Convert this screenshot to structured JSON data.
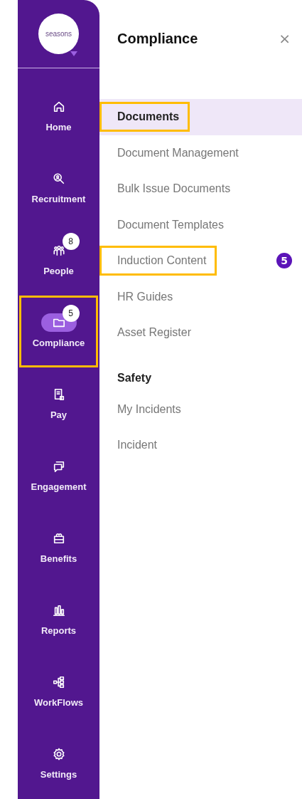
{
  "logo": {
    "text": "seasons"
  },
  "nav": [
    {
      "label": "Home",
      "kind": "home",
      "selected": false,
      "highlighted": false
    },
    {
      "label": "Recruitment",
      "kind": "recruit",
      "selected": false,
      "highlighted": false
    },
    {
      "label": "People",
      "kind": "people",
      "selected": false,
      "highlighted": false,
      "badge": "8"
    },
    {
      "label": "Compliance",
      "kind": "compliance",
      "selected": true,
      "highlighted": true,
      "badge": "5"
    },
    {
      "label": "Pay",
      "kind": "pay",
      "selected": false,
      "highlighted": false
    },
    {
      "label": "Engagement",
      "kind": "engagement",
      "selected": false,
      "highlighted": false
    },
    {
      "label": "Benefits",
      "kind": "benefits",
      "selected": false,
      "highlighted": false
    },
    {
      "label": "Reports",
      "kind": "reports",
      "selected": false,
      "highlighted": false
    },
    {
      "label": "WorkFlows",
      "kind": "workflows",
      "selected": false,
      "highlighted": false
    },
    {
      "label": "Settings",
      "kind": "settings",
      "selected": false,
      "highlighted": false
    }
  ],
  "panel": {
    "title": "Compliance",
    "close": "×",
    "sections": [
      {
        "items": [
          {
            "label": "Documents",
            "kind": "header",
            "selected": true,
            "highlighted": true
          },
          {
            "label": "Document Management",
            "kind": "link",
            "selected": false,
            "highlighted": false
          },
          {
            "label": "Bulk Issue Documents",
            "kind": "link",
            "selected": false,
            "highlighted": false
          },
          {
            "label": "Document Templates",
            "kind": "link",
            "selected": false,
            "highlighted": false
          },
          {
            "label": "Induction Content",
            "kind": "link",
            "selected": false,
            "highlighted": true,
            "badge": "5"
          },
          {
            "label": "HR Guides",
            "kind": "link",
            "selected": false,
            "highlighted": false
          },
          {
            "label": "Asset Register",
            "kind": "link",
            "selected": false,
            "highlighted": false
          }
        ]
      },
      {
        "heading": "Safety",
        "items": [
          {
            "label": "My Incidents",
            "kind": "link",
            "selected": false,
            "highlighted": false
          },
          {
            "label": "Incident",
            "kind": "link",
            "selected": false,
            "highlighted": false
          }
        ]
      }
    ]
  }
}
